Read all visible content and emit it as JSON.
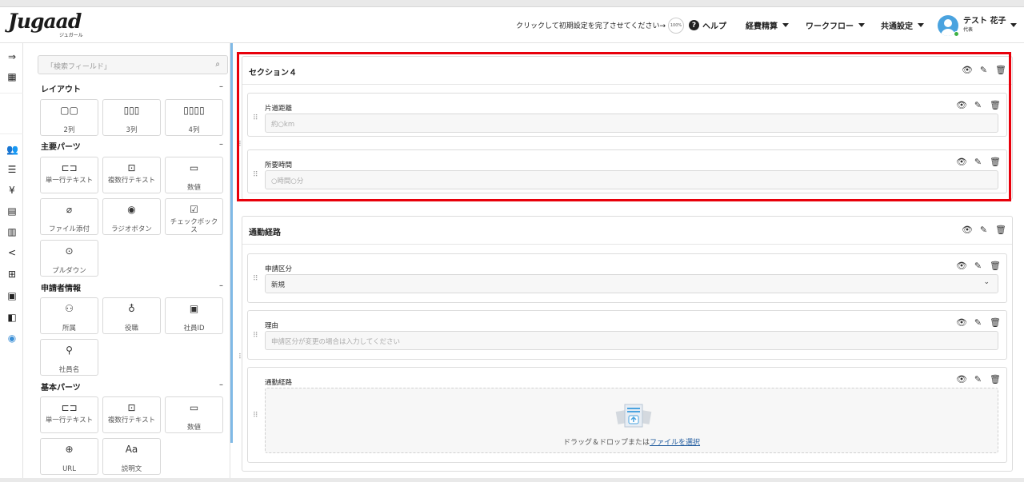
{
  "header": {
    "logo": "Jugaad",
    "logo_sub": "ジュガール",
    "setup_prompt": "クリックして初期設定を完了させてください→",
    "setup_percent": "100%",
    "help": "ヘルプ",
    "menus": [
      "経費精算",
      "ワークフロー",
      "共通設定"
    ],
    "user_name": "テスト 花子",
    "user_role": "代表"
  },
  "palette": {
    "search_placeholder": "「検索フィールド」",
    "categories": [
      {
        "title": "レイアウト",
        "items": [
          {
            "icon": "two-column-icon",
            "label": "2列"
          },
          {
            "icon": "three-column-icon",
            "label": "3列"
          },
          {
            "icon": "four-column-icon",
            "label": "4列"
          }
        ]
      },
      {
        "title": "主要パーツ",
        "items": [
          {
            "icon": "single-line-text-icon",
            "label": "単一行テキスト"
          },
          {
            "icon": "multi-line-text-icon",
            "label": "複数行テキスト"
          },
          {
            "icon": "number-icon",
            "label": "数値"
          },
          {
            "icon": "paperclip-icon",
            "label": "ファイル添付"
          },
          {
            "icon": "radio-button-icon",
            "label": "ラジオボタン"
          },
          {
            "icon": "checkbox-icon",
            "label": "チェックボックス"
          },
          {
            "icon": "dropdown-icon",
            "label": "プルダウン"
          }
        ]
      },
      {
        "title": "申請者情報",
        "items": [
          {
            "icon": "department-icon",
            "label": "所属"
          },
          {
            "icon": "position-icon",
            "label": "役職"
          },
          {
            "icon": "employee-id-icon",
            "label": "社員ID"
          },
          {
            "icon": "employee-name-icon",
            "label": "社員名"
          }
        ]
      },
      {
        "title": "基本パーツ",
        "items": [
          {
            "icon": "single-line-text-icon",
            "label": "単一行テキスト"
          },
          {
            "icon": "multi-line-text-icon",
            "label": "複数行テキスト"
          },
          {
            "icon": "number-icon",
            "label": "数値"
          },
          {
            "icon": "globe-icon",
            "label": "URL"
          },
          {
            "icon": "text-format-icon",
            "label": "説明文"
          }
        ]
      }
    ]
  },
  "sections": [
    {
      "title": "セクション４",
      "fields": [
        {
          "label": "片道距離",
          "placeholder": "約○km"
        },
        {
          "label": "所要時間",
          "placeholder": "○時間○分"
        }
      ]
    },
    {
      "title": "通勤経路",
      "fields": [
        {
          "label": "申請区分",
          "value": "新規"
        },
        {
          "label": "理由",
          "placeholder": "申請区分が変更の場合は入力してください"
        },
        {
          "label": "通勤経路",
          "upload_text": "ドラッグ＆ドロップまたは",
          "upload_link": "ファイルを選択"
        }
      ]
    }
  ],
  "colors": {
    "highlight": "#e8000b",
    "accent": "#7fb9e6",
    "link": "#1f5a9e"
  }
}
